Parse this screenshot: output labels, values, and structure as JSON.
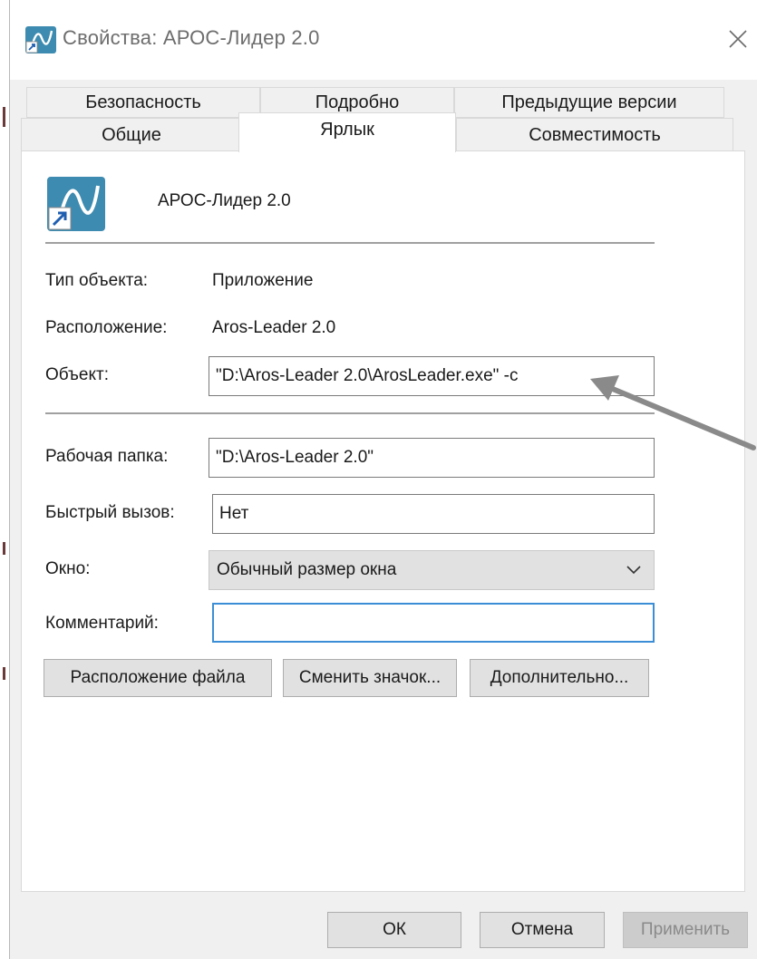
{
  "window": {
    "title": "Свойства: АРОС-Лидер 2.0",
    "title_icon": "app-icon",
    "close_icon": "close-icon"
  },
  "tabs": {
    "row1": [
      "Безопасность",
      "Подробно",
      "Предыдущие версии"
    ],
    "row2": [
      "Общие",
      "Ярлык",
      "Совместимость"
    ],
    "selected": "Ярлык"
  },
  "shortcut": {
    "app_name": "АРОС-Лидер 2.0",
    "icon": "app-icon",
    "type_label": "Тип объекта:",
    "type_value": "Приложение",
    "location_label": "Расположение:",
    "location_value": "Aros-Leader 2.0",
    "target_label": "Объект:",
    "target_value": "\"D:\\Aros-Leader 2.0\\ArosLeader.exe\" -c",
    "workdir_label": "Рабочая папка:",
    "workdir_value": "\"D:\\Aros-Leader 2.0\"",
    "hotkey_label": "Быстрый вызов:",
    "hotkey_value": "Нет",
    "run_label": "Окно:",
    "run_value": "Обычный размер окна",
    "comment_label": "Комментарий:",
    "comment_value": ""
  },
  "buttons": {
    "open_location": "Расположение файла",
    "change_icon": "Сменить значок...",
    "advanced": "Дополнительно...",
    "ok": "ОК",
    "cancel": "Отмена",
    "apply": "Применить"
  },
  "colors": {
    "accent_focus": "#3b8ed6",
    "icon_teal": "#3d8bb0",
    "arrow_gray": "#8a8a8a"
  }
}
